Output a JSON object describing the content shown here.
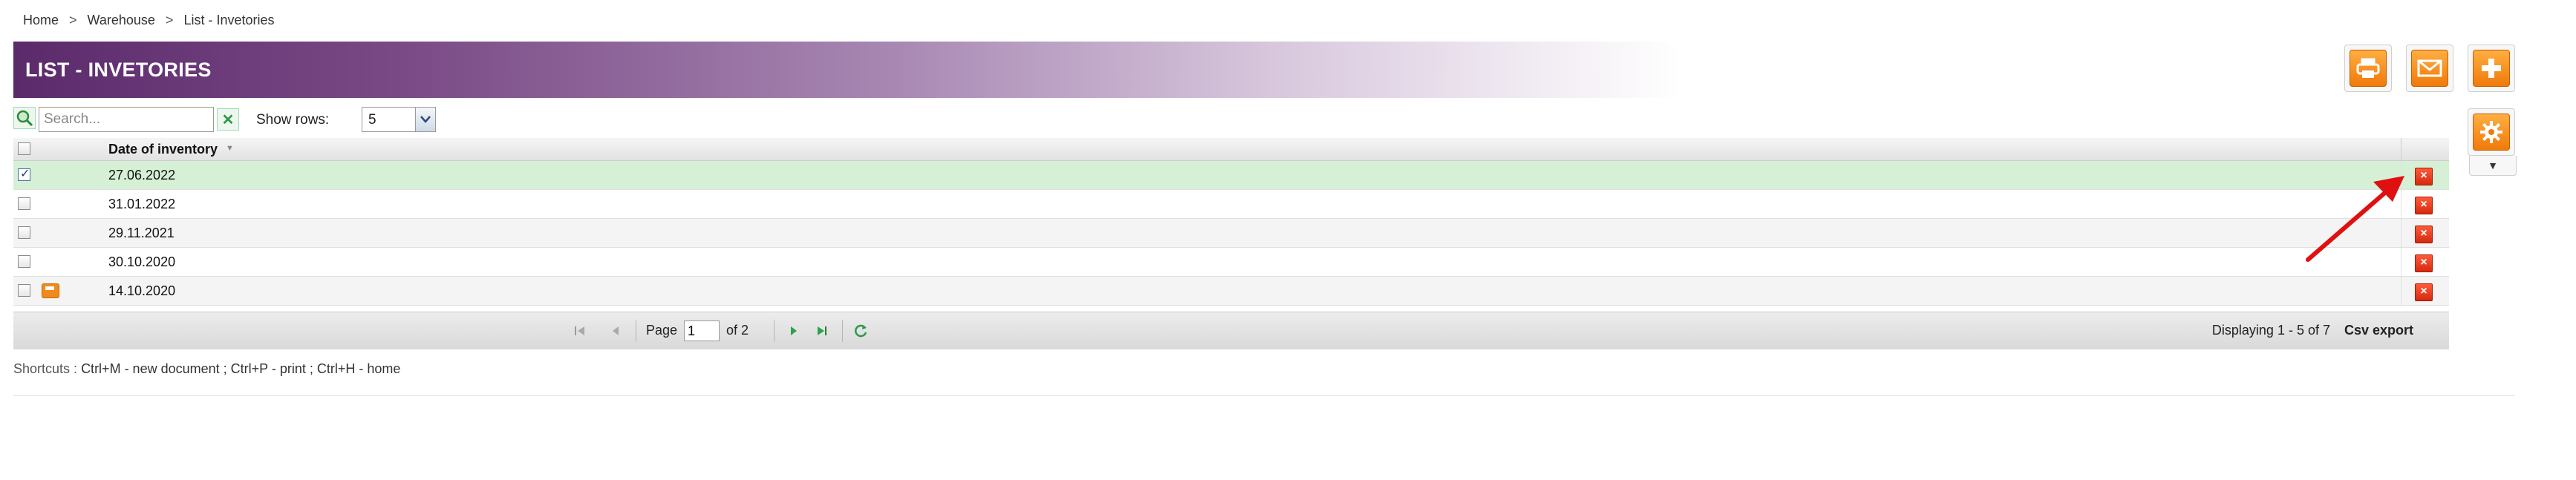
{
  "breadcrumb": {
    "items": [
      "Home",
      "Warehouse",
      "List - Invetories"
    ],
    "separator": ">"
  },
  "header": {
    "title": "LIST - INVETORIES",
    "gradient_start": "#5b2a6b"
  },
  "toolbar": {
    "buttons": [
      {
        "name": "print",
        "icon": "printer-icon"
      },
      {
        "name": "email",
        "icon": "envelope-icon"
      },
      {
        "name": "add",
        "icon": "plus-icon"
      },
      {
        "name": "settings",
        "icon": "gear-icon"
      }
    ],
    "dropdown_glyph": "▼",
    "accent": "#f07a0a"
  },
  "search": {
    "placeholder": "Search...",
    "value": "",
    "show_rows_label": "Show rows:",
    "show_rows_value": "5"
  },
  "grid": {
    "column_header": "Date of inventory",
    "rows": [
      {
        "date": "27.06.2022",
        "checked": true,
        "selected": true,
        "printed": false
      },
      {
        "date": "31.01.2022",
        "checked": false,
        "selected": false,
        "printed": false
      },
      {
        "date": "29.11.2021",
        "checked": false,
        "selected": false,
        "printed": false
      },
      {
        "date": "30.10.2020",
        "checked": false,
        "selected": false,
        "printed": false
      },
      {
        "date": "14.10.2020",
        "checked": false,
        "selected": false,
        "printed": true
      }
    ],
    "delete_glyph": "×",
    "selected_row_color": "#d6f0d6"
  },
  "pager": {
    "page_label": "Page",
    "page_value": "1",
    "of_label": "of 2",
    "displaying": "Displaying 1 - 5 of 7",
    "csv_export": "Csv export"
  },
  "shortcuts": {
    "label": "Shortcuts :",
    "text": "Ctrl+M - new document ;   Ctrl+P - print ;   Ctrl+H - home"
  },
  "annotation": {
    "arrow_color": "#e01010"
  }
}
